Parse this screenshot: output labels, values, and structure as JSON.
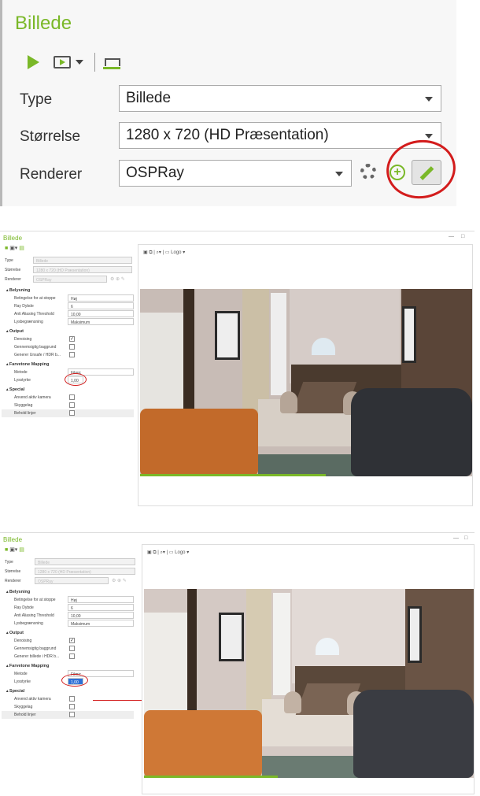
{
  "top": {
    "title": "Billede",
    "type_label": "Type",
    "type_value": "Billede",
    "size_label": "Størrelse",
    "size_value": "1280 x 720 (HD Præsentation)",
    "renderer_label": "Renderer",
    "renderer_value": "OSPRay"
  },
  "panel1": {
    "title": "Billede",
    "viewer_toolbar": "Logo",
    "type_label": "Type",
    "type_value": "Billede",
    "size_label": "Størrelse",
    "size_value": "1280 x 720 (HD Præsentation)",
    "renderer_label": "Renderer",
    "renderer_value": "OSPRay",
    "sections": {
      "belysning": "Belysning",
      "output": "Output",
      "tone": "Farvetone Mapping",
      "special": "Special"
    },
    "rows": {
      "stop_label": "Betingelse for at stoppe",
      "stop_value": "Høj",
      "depth_label": "Ray Dybde",
      "depth_value": "6",
      "aa_label": "Anti Aliasing Threshold",
      "aa_value": "10,00",
      "light_label": "Lysbegrænsning",
      "light_value": "Maksimum",
      "denoise_label": "Denoising",
      "transparent_label": "Gennemsigtig baggrund",
      "hdr_label": "Generer Unsafe / HDR b...",
      "method_label": "Metode",
      "method_value": "Filmic",
      "brightness_label": "Lysstyrke",
      "brightness_value": "1,00",
      "camera_label": "Anvend aktiv kamera",
      "shadow_label": "Skyggelag",
      "lines_label": "Behold linjer"
    }
  },
  "panel2": {
    "title": "Billede",
    "viewer_toolbar": "Logo",
    "type_label": "Type",
    "type_value": "Billede",
    "size_label": "Størrelse",
    "size_value": "1280 x 720 (HD Præsentation)",
    "renderer_label": "Renderer",
    "renderer_value": "OSPRay",
    "sections": {
      "belysning": "Belysning",
      "output": "Output",
      "tone": "Farvetone Mapping",
      "special": "Special"
    },
    "rows": {
      "stop_label": "Betingelse for at stoppe",
      "stop_value": "Høj",
      "depth_label": "Ray Dybde",
      "depth_value": "6",
      "aa_label": "Anti Aliasing Threshold",
      "aa_value": "10,00",
      "light_label": "Lysbegrænsning",
      "light_value": "Maksimum",
      "denoise_label": "Denoising",
      "transparent_label": "Gennemsigtig baggrund",
      "hdr_label": "Generer billede i HDR b...",
      "method_label": "Metode",
      "method_value": "Filmic",
      "brightness_label": "Lysstyrke",
      "brightness_value": "1,00",
      "camera_label": "Anvend aktiv kamera",
      "shadow_label": "Skyggelag",
      "lines_label": "Behold linjer"
    }
  },
  "colors": {
    "accent": "#7ab828",
    "annotation": "#d31c1c"
  }
}
